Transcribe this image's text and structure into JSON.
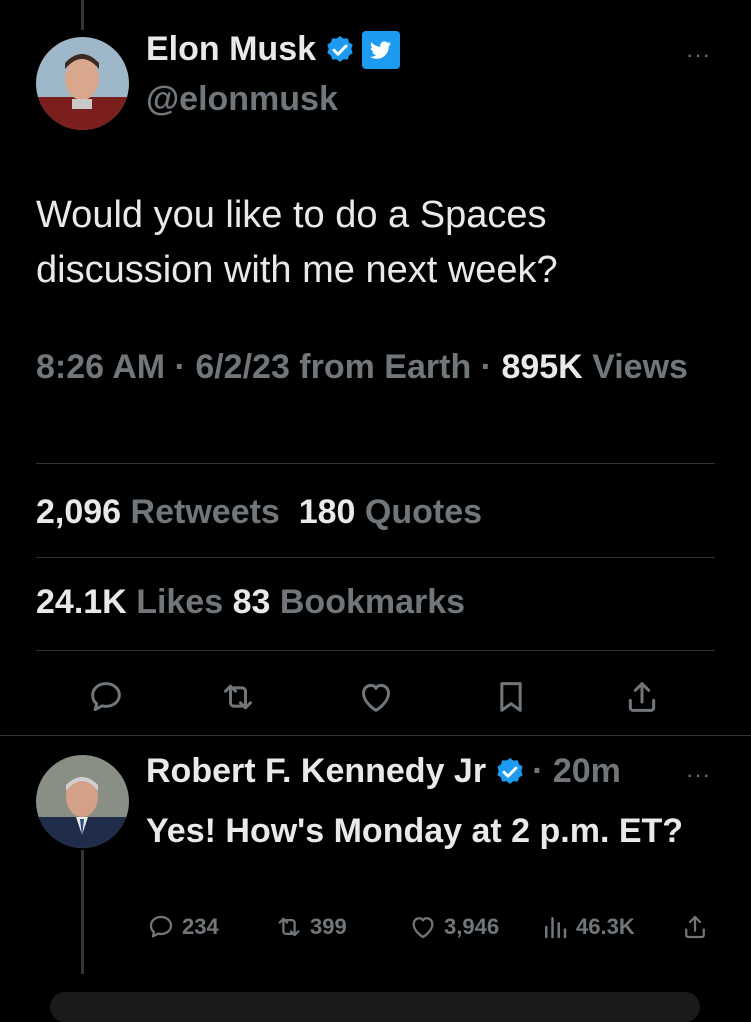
{
  "main_tweet": {
    "author_name": "Elon Musk",
    "handle": "@elonmusk",
    "text": "Would you like to do a Spaces discussion with me next week?",
    "meta_time": "8:26 AM · 6/2/23 from Earth · ",
    "views_count": "895K",
    "views_label": "Views",
    "retweets_count": "2,096",
    "retweets_label": "Retweets",
    "quotes_count": "180",
    "quotes_label": "Quotes",
    "likes_count": "24.1K",
    "likes_label": "Likes",
    "bookmarks_count": "83",
    "bookmarks_label": "Bookmarks",
    "more_label": "···"
  },
  "reply": {
    "author_name": "Robert F. Kennedy Jr",
    "time": "· 20m",
    "text": "Yes! How's Monday at 2 p.m. ET?",
    "reply_count": "234",
    "retweet_count": "399",
    "like_count": "3,946",
    "view_count": "46.3K",
    "more_label": "···"
  },
  "colors": {
    "background": "#000000",
    "text": "#e7e9ea",
    "muted": "#71767b",
    "verified": "#1d9bf0"
  },
  "icons": [
    "verified-badge-icon",
    "twitter-bird-badge-icon",
    "reply-icon",
    "retweet-icon",
    "like-icon",
    "bookmark-icon",
    "share-icon",
    "views-icon"
  ]
}
